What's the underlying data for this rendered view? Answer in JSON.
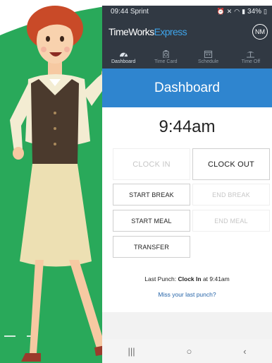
{
  "status": {
    "time": "09:44",
    "carrier": "Sprint",
    "battery": "34%"
  },
  "app": {
    "brand_main": "TimeWorks",
    "brand_accent": "Express",
    "avatar_initials": "NM"
  },
  "tabs": [
    {
      "label": "Dashboard",
      "icon": "speedometer-icon",
      "active": true
    },
    {
      "label": "Time Card",
      "icon": "timecard-icon",
      "active": false
    },
    {
      "label": "Schedule",
      "icon": "calendar-icon",
      "active": false
    },
    {
      "label": "Time Off",
      "icon": "beach-icon",
      "active": false
    }
  ],
  "dashboard": {
    "title": "Dashboard",
    "current_time": "9:44am",
    "buttons": {
      "clock_in": "CLOCK IN",
      "clock_out": "CLOCK OUT",
      "start_break": "START BREAK",
      "end_break": "END BREAK",
      "start_meal": "START MEAL",
      "end_meal": "END MEAL",
      "transfer": "TRANSFER"
    },
    "last_punch_label": "Last Punch:",
    "last_punch_type": "Clock In",
    "last_punch_at": "at 9:41am",
    "miss_link": "Miss your last punch?"
  },
  "navbar": {
    "recents": "|||",
    "home": "○",
    "back": "‹"
  },
  "colors": {
    "appbar": "#313943",
    "accent": "#2f85cf",
    "brand_accent": "#3ea4ea",
    "bg_green": "#29a95a"
  }
}
